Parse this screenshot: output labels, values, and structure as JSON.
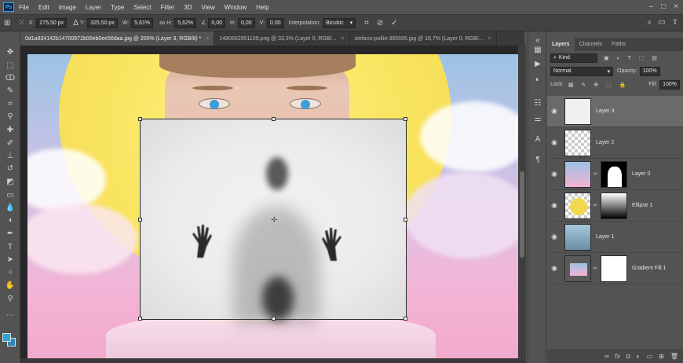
{
  "menu": {
    "logo": "Ps",
    "items": [
      "File",
      "Edit",
      "Image",
      "Layer",
      "Type",
      "Select",
      "Filter",
      "3D",
      "View",
      "Window",
      "Help"
    ]
  },
  "options": {
    "x_label": "X:",
    "x_value": "275,50 px",
    "y_label": "Y:",
    "y_value": "325,50 px",
    "w_label": "W:",
    "w_value": "5,61%",
    "h_label": "H:",
    "h_value": "5,62%",
    "angle_value": "0,00",
    "hskew_label": "H:",
    "hskew_value": "0,00",
    "vskew_label": "V:",
    "vskew_value": "0,00",
    "interp_label": "Interpolation:",
    "interp_value": "Bicubic"
  },
  "tabs": [
    {
      "label": "0d1a834142b14700972b00eb0ee56daa.jpg @ 200% (Layer 3, RGB/8) *",
      "close": "×"
    },
    {
      "label": "1480662951109.png @ 33,3% (Layer 0, RGB/...",
      "close": "×"
    },
    {
      "label": "stefano-pollio-365695.jpg @ 16,7% (Layer 0, RGB/...",
      "close": "×"
    }
  ],
  "panel": {
    "tabs": [
      "Layers",
      "Channels",
      "Paths"
    ],
    "kind_label": "Kind",
    "blend_mode": "Normal",
    "opacity_label": "Opacity:",
    "opacity_value": "100%",
    "lock_label": "Lock:",
    "fill_label": "Fill:",
    "fill_value": "100%",
    "layers": [
      {
        "name": "Layer 3",
        "selected": true
      },
      {
        "name": "Layer 2",
        "selected": false
      },
      {
        "name": "Layer 0",
        "selected": false
      },
      {
        "name": "Ellipse 1",
        "selected": false
      },
      {
        "name": "Layer 1",
        "selected": false
      },
      {
        "name": "Gradient Fill 1",
        "selected": false
      }
    ]
  },
  "colors": {
    "foreground": "#2da6d8",
    "background": "#2d84b8",
    "accent": "#31a8ff"
  }
}
